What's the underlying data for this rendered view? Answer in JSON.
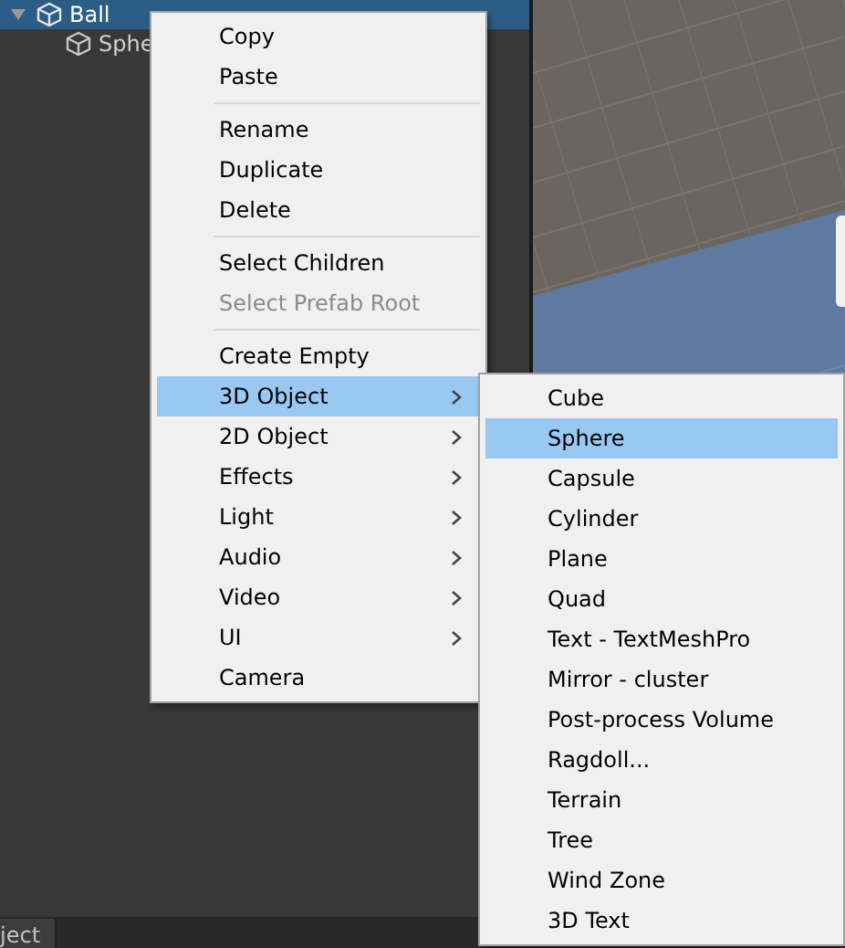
{
  "hierarchy": {
    "rows": [
      {
        "label": "Ball",
        "selected": true,
        "expanded": true,
        "children": [
          {
            "label": "Sphe",
            "selected": false
          }
        ]
      }
    ]
  },
  "bottom_tab": {
    "label": "ject"
  },
  "context_menu": {
    "items": [
      {
        "kind": "item",
        "label": "Copy",
        "disabled": false,
        "selected": false,
        "submenu": false
      },
      {
        "kind": "item",
        "label": "Paste",
        "disabled": false,
        "selected": false,
        "submenu": false
      },
      {
        "kind": "separator"
      },
      {
        "kind": "item",
        "label": "Rename",
        "disabled": false,
        "selected": false,
        "submenu": false
      },
      {
        "kind": "item",
        "label": "Duplicate",
        "disabled": false,
        "selected": false,
        "submenu": false
      },
      {
        "kind": "item",
        "label": "Delete",
        "disabled": false,
        "selected": false,
        "submenu": false
      },
      {
        "kind": "separator"
      },
      {
        "kind": "item",
        "label": "Select Children",
        "disabled": false,
        "selected": false,
        "submenu": false
      },
      {
        "kind": "item",
        "label": "Select Prefab Root",
        "disabled": true,
        "selected": false,
        "submenu": false
      },
      {
        "kind": "separator"
      },
      {
        "kind": "item",
        "label": "Create Empty",
        "disabled": false,
        "selected": false,
        "submenu": false
      },
      {
        "kind": "item",
        "label": "3D Object",
        "disabled": false,
        "selected": true,
        "submenu": true
      },
      {
        "kind": "item",
        "label": "2D Object",
        "disabled": false,
        "selected": false,
        "submenu": true
      },
      {
        "kind": "item",
        "label": "Effects",
        "disabled": false,
        "selected": false,
        "submenu": true
      },
      {
        "kind": "item",
        "label": "Light",
        "disabled": false,
        "selected": false,
        "submenu": true
      },
      {
        "kind": "item",
        "label": "Audio",
        "disabled": false,
        "selected": false,
        "submenu": true
      },
      {
        "kind": "item",
        "label": "Video",
        "disabled": false,
        "selected": false,
        "submenu": true
      },
      {
        "kind": "item",
        "label": "UI",
        "disabled": false,
        "selected": false,
        "submenu": true
      },
      {
        "kind": "item",
        "label": "Camera",
        "disabled": false,
        "selected": false,
        "submenu": false
      }
    ]
  },
  "submenu": {
    "items": [
      {
        "kind": "item",
        "label": "Cube",
        "disabled": false,
        "selected": false,
        "submenu": false
      },
      {
        "kind": "item",
        "label": "Sphere",
        "disabled": false,
        "selected": true,
        "submenu": false
      },
      {
        "kind": "item",
        "label": "Capsule",
        "disabled": false,
        "selected": false,
        "submenu": false
      },
      {
        "kind": "item",
        "label": "Cylinder",
        "disabled": false,
        "selected": false,
        "submenu": false
      },
      {
        "kind": "item",
        "label": "Plane",
        "disabled": false,
        "selected": false,
        "submenu": false
      },
      {
        "kind": "item",
        "label": "Quad",
        "disabled": false,
        "selected": false,
        "submenu": false
      },
      {
        "kind": "item",
        "label": "Text - TextMeshPro",
        "disabled": false,
        "selected": false,
        "submenu": false
      },
      {
        "kind": "item",
        "label": "Mirror - cluster",
        "disabled": false,
        "selected": false,
        "submenu": false
      },
      {
        "kind": "item",
        "label": "Post-process Volume",
        "disabled": false,
        "selected": false,
        "submenu": false
      },
      {
        "kind": "item",
        "label": "Ragdoll...",
        "disabled": false,
        "selected": false,
        "submenu": false
      },
      {
        "kind": "item",
        "label": "Terrain",
        "disabled": false,
        "selected": false,
        "submenu": false
      },
      {
        "kind": "item",
        "label": "Tree",
        "disabled": false,
        "selected": false,
        "submenu": false
      },
      {
        "kind": "item",
        "label": "Wind Zone",
        "disabled": false,
        "selected": false,
        "submenu": false
      },
      {
        "kind": "item",
        "label": "3D Text",
        "disabled": false,
        "selected": false,
        "submenu": false
      }
    ]
  }
}
